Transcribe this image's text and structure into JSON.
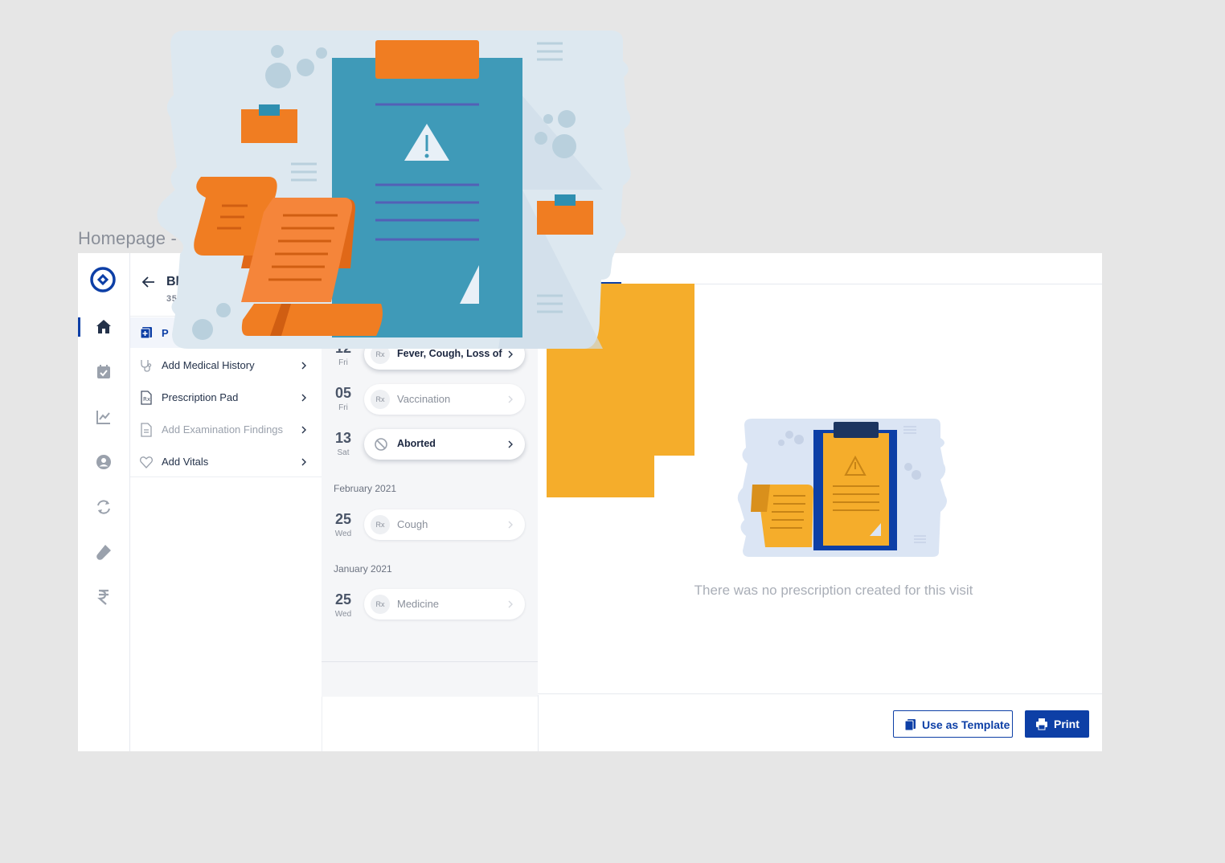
{
  "frame": {
    "title": "Homepage - Welcome Screen"
  },
  "patient": {
    "name": "Bhaska",
    "meta": "35 YRS / I"
  },
  "menu": {
    "active_label": "P",
    "items": [
      {
        "label": "Add Medical History",
        "icon": "stethoscope-icon",
        "muted": false
      },
      {
        "label": "Prescription Pad",
        "icon": "rx-document-icon",
        "muted": false
      },
      {
        "label": "Add Examination Findings",
        "icon": "document-icon",
        "muted": true
      },
      {
        "label": "Add Vitals",
        "icon": "heart-icon",
        "muted": false
      }
    ]
  },
  "visits": [
    {
      "day": "12",
      "dow": "Fri",
      "label": "Fever, Cough, Loss of",
      "badge": "Rx",
      "state": "active"
    },
    {
      "day": "05",
      "dow": "Fri",
      "label": "Vaccination",
      "badge": "Rx",
      "state": "normal"
    },
    {
      "day": "13",
      "dow": "Sat",
      "label": "Aborted",
      "badge": "blocked-icon",
      "state": "aborted"
    }
  ],
  "months": [
    {
      "label": "February 2021",
      "visits": [
        {
          "day": "25",
          "dow": "Wed",
          "label": "Cough",
          "badge": "Rx"
        }
      ]
    },
    {
      "label": "January 2021",
      "visits": [
        {
          "day": "25",
          "dow": "Wed",
          "label": "Medicine",
          "badge": "Rx"
        }
      ]
    }
  ],
  "main": {
    "empty_message": "There was no prescription created for this visit"
  },
  "actions": {
    "template_label": "Use as Template",
    "print_label": "Print"
  },
  "colors": {
    "primary": "#0d3fa6",
    "accent_orange": "#f07d22",
    "clipboard_teal": "#3f9ab8",
    "empty_yellow": "#f5ad2b"
  },
  "rail_icons": [
    "home-icon",
    "calendar-check-icon",
    "chart-icon",
    "user-circle-icon",
    "sync-icon",
    "test-tube-icon",
    "rupee-icon"
  ]
}
